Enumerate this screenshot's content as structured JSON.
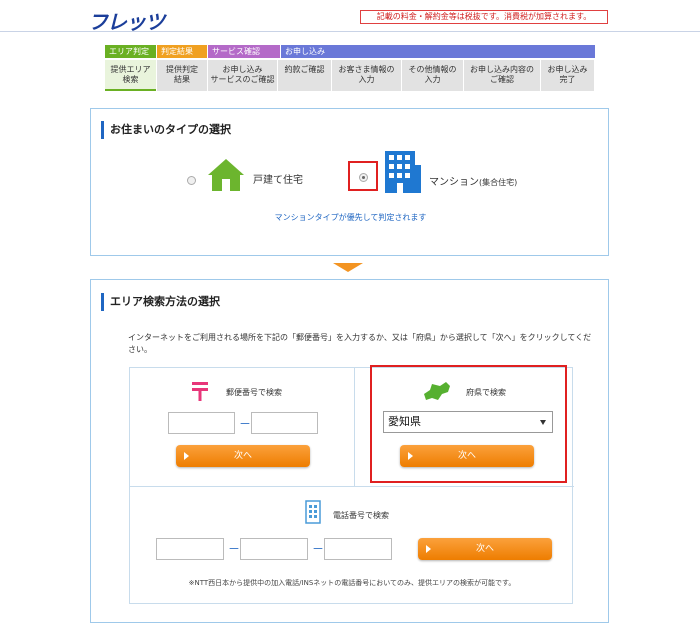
{
  "header": {
    "logo_text": "フレッツ",
    "notice": "記載の料金・解約金等は税抜です。消費税が加算されます。"
  },
  "steps": {
    "tags": [
      "エリア判定",
      "判定結果",
      "サービス確認",
      "お申し込み"
    ],
    "items": [
      "提供エリア\n検索",
      "提供判定\n結果",
      "お申し込み\nサービスのご確認",
      "約款ご確認",
      "お客さま情報の\n入力",
      "その他情報の\n入力",
      "お申し込み内容の\nご確認",
      "お申し込み\n完了"
    ]
  },
  "residence": {
    "title": "お住まいのタイプの選択",
    "house_label": "戸建て住宅",
    "mansion_label": "マンション",
    "mansion_sub": "(集合住宅)",
    "selected": "mansion",
    "priority_note": "マンションタイプが優先して判定されます"
  },
  "area_search": {
    "title": "エリア検索方法の選択",
    "description": "インターネットをご利用される場所を下記の「郵便番号」を入力するか、又は「府県」から選択して「次へ」をクリックしてください。",
    "postal": {
      "label": "郵便番号で検索",
      "field1_value": "",
      "field2_value": "",
      "dash": "－",
      "next_label": "次へ"
    },
    "prefecture": {
      "label": "府県で検索",
      "selected_value": "愛知県",
      "next_label": "次へ"
    },
    "phone": {
      "label": "電話番号で検索",
      "dash": "－",
      "next_label": "次へ",
      "note": "※NTT西日本から提供中の加入電話/INSネットの電話番号においてのみ、提供エリアの検索が可能です。"
    }
  },
  "colors": {
    "brand_blue": "#1b3e9a",
    "accent_orange": "#ee7d00",
    "highlight_red": "#e02020",
    "tag_green": "#6ab023",
    "tag_orange": "#f0a020",
    "tag_purple": "#b46ac8",
    "tag_blue": "#6a78d8"
  }
}
